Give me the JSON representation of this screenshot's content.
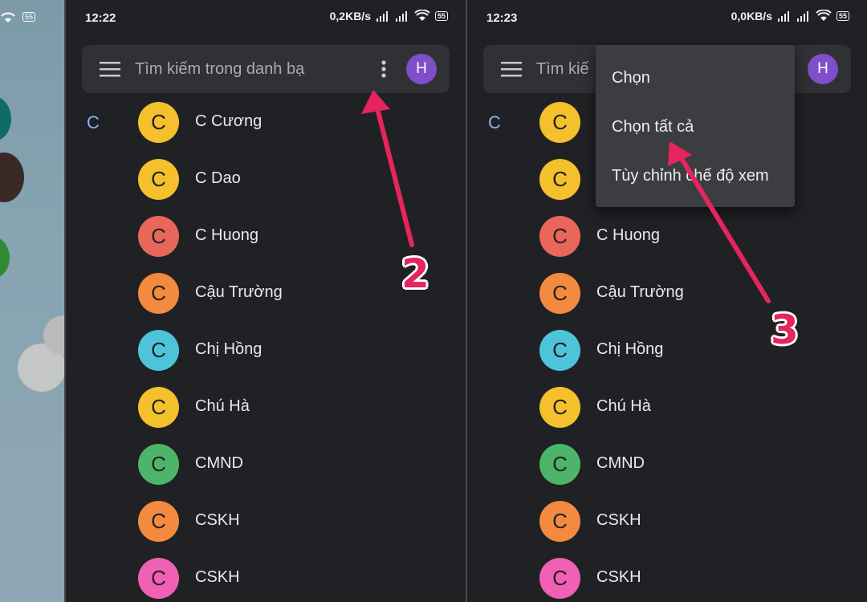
{
  "left_status": {
    "battery": "55"
  },
  "panel1": {
    "status": {
      "time": "12:22",
      "speed": "0,2KB/s",
      "battery": "55"
    },
    "search": {
      "placeholder": "Tìm kiếm trong danh bạ",
      "avatar_letter": "H"
    },
    "letter_header": "C",
    "contacts": [
      {
        "initial": "C",
        "name": "C Cương",
        "color": "#f4c02c"
      },
      {
        "initial": "C",
        "name": "C Dao",
        "color": "#f4c02c"
      },
      {
        "initial": "C",
        "name": "C Huong",
        "color": "#e8675a"
      },
      {
        "initial": "C",
        "name": "Cậu Trường",
        "color": "#f48a3f"
      },
      {
        "initial": "C",
        "name": "Chị Hồng",
        "color": "#4dc4d9"
      },
      {
        "initial": "C",
        "name": "Chú Hà",
        "color": "#f4c02c"
      },
      {
        "initial": "C",
        "name": "CMND",
        "color": "#4db56a"
      },
      {
        "initial": "C",
        "name": "CSKH",
        "color": "#f48a3f"
      },
      {
        "initial": "C",
        "name": "CSKH",
        "color": "#f060b4"
      }
    ],
    "callout": "2"
  },
  "panel2": {
    "status": {
      "time": "12:23",
      "speed": "0,0KB/s",
      "battery": "55"
    },
    "search": {
      "placeholder": "Tìm kiế",
      "avatar_letter": "H"
    },
    "letter_header": "C",
    "menu": {
      "items": [
        "Chọn",
        "Chọn tất cả",
        "Tùy chỉnh chế độ xem"
      ]
    },
    "contacts": [
      {
        "initial": "C",
        "name": "",
        "color": "#f4c02c"
      },
      {
        "initial": "C",
        "name": "",
        "color": "#f4c02c"
      },
      {
        "initial": "C",
        "name": "C Huong",
        "color": "#e8675a"
      },
      {
        "initial": "C",
        "name": "Cậu Trường",
        "color": "#f48a3f"
      },
      {
        "initial": "C",
        "name": "Chị Hồng",
        "color": "#4dc4d9"
      },
      {
        "initial": "C",
        "name": "Chú Hà",
        "color": "#f4c02c"
      },
      {
        "initial": "C",
        "name": "CMND",
        "color": "#4db56a"
      },
      {
        "initial": "C",
        "name": "CSKH",
        "color": "#f48a3f"
      },
      {
        "initial": "C",
        "name": "CSKH",
        "color": "#f060b4"
      }
    ],
    "callout": "3"
  },
  "colors": {
    "accent_pink": "#e6245e",
    "avatar_purple": "#7e4fc8",
    "link_blue": "#8ab4f8"
  }
}
